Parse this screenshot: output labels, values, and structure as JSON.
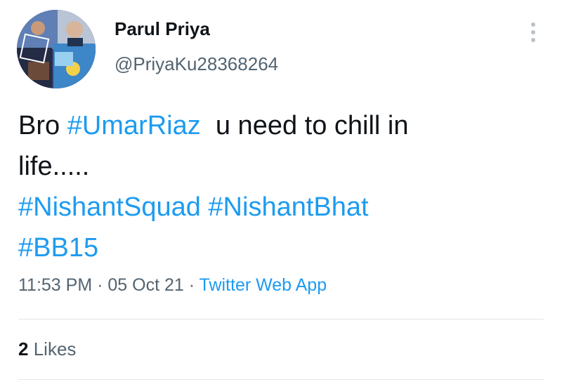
{
  "author": {
    "display_name": "Parul Priya",
    "handle": "@PriyaKu28368264",
    "avatar_icon": "profile-photo-collage"
  },
  "more_icon": "more-vertical-icon",
  "tweet": {
    "line1_prefix": "Bro ",
    "hashtag_1": "#UmarRiaz",
    "line1_suffix": "  u need to chill in",
    "line2": "life.....",
    "hashtag_2": "#NishantSquad",
    "hashtag_3": "#NishantBhat",
    "hashtag_4": "#BB15"
  },
  "meta": {
    "time": "11:53 PM",
    "separator_1": " · ",
    "date": "05 Oct 21",
    "separator_2": " · ",
    "source": "Twitter Web App"
  },
  "stats": {
    "likes_count": "2",
    "likes_label": "Likes"
  },
  "colors": {
    "text": "#0f1419",
    "secondary": "#536471",
    "link": "#1d9bf0",
    "divider": "#e1e6ea"
  }
}
